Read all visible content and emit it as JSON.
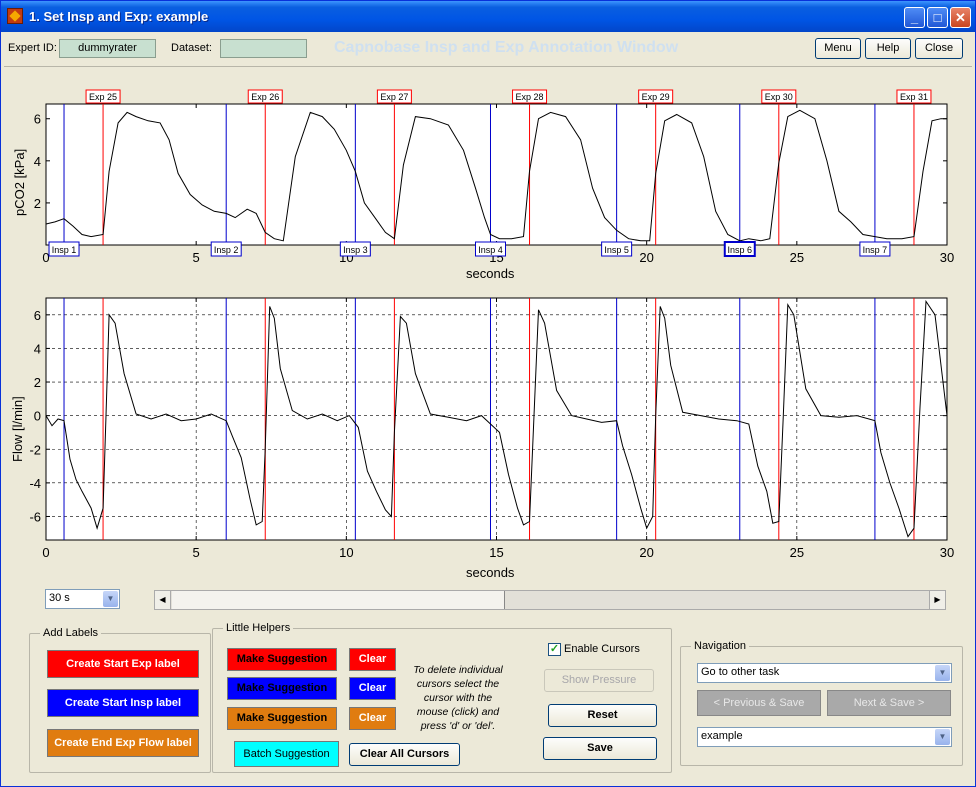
{
  "window": {
    "title": "1. Set Insp and Exp: example"
  },
  "header": {
    "expert_label": "Expert ID:",
    "expert_value": "dummyrater",
    "dataset_label": "Dataset:",
    "dataset_value": "",
    "big_title": "Capnobase Insp and Exp Annotation Window",
    "menu_label": "Menu",
    "help_label": "Help",
    "close_label": "Close"
  },
  "chart_data": [
    {
      "type": "line",
      "ylabel": "pCO2 [kPa]",
      "xlabel": "seconds",
      "xlim": [
        0,
        30
      ],
      "ylim": [
        0,
        6.7
      ],
      "xticks": [
        0,
        5,
        10,
        15,
        20,
        25,
        30
      ],
      "yticks": [
        2,
        4,
        6
      ],
      "grid": false,
      "exp_labels": [
        {
          "label": "Exp 25",
          "x": 1.9
        },
        {
          "label": "Exp 26",
          "x": 7.3
        },
        {
          "label": "Exp 27",
          "x": 11.6
        },
        {
          "label": "Exp 28",
          "x": 16.1
        },
        {
          "label": "Exp 29",
          "x": 20.3
        },
        {
          "label": "Exp 30",
          "x": 24.4
        },
        {
          "label": "Exp 31",
          "x": 28.9
        }
      ],
      "insp_labels": [
        {
          "label": "Insp 1",
          "x": 0.6
        },
        {
          "label": "Insp 2",
          "x": 6.0
        },
        {
          "label": "Insp 3",
          "x": 10.3
        },
        {
          "label": "Insp 4",
          "x": 14.8
        },
        {
          "label": "Insp 5",
          "x": 19.0
        },
        {
          "label": "Insp 6",
          "x": 23.1
        },
        {
          "label": "Insp 7",
          "x": 27.6
        }
      ],
      "series": [
        {
          "x": [
            0,
            0.3,
            0.6,
            0.9,
            1.2,
            1.5,
            1.9,
            2.1,
            2.4,
            2.7,
            3.0,
            3.4,
            3.8,
            4.1,
            4.4,
            4.8,
            5.2,
            5.6,
            6.0,
            6.3,
            6.7,
            7.0,
            7.3,
            7.6,
            7.9,
            8.3,
            8.8,
            9.2,
            9.6,
            10.0,
            10.3,
            10.6,
            11.0,
            11.3,
            11.6,
            11.9,
            12.3,
            12.8,
            13.4,
            13.9,
            14.3,
            14.6,
            14.8,
            15.1,
            15.5,
            15.9,
            16.1,
            16.4,
            16.8,
            17.3,
            17.8,
            18.2,
            18.6,
            19.0,
            19.4,
            19.8,
            20.1,
            20.3,
            20.6,
            21.0,
            21.5,
            21.9,
            22.3,
            22.7,
            23.1,
            23.4,
            23.8,
            24.1,
            24.4,
            24.7,
            25.1,
            25.6,
            26.0,
            26.4,
            26.8,
            27.2,
            27.6,
            28.0,
            28.5,
            28.9,
            29.2,
            29.5,
            29.8,
            30.0
          ],
          "y": [
            1.0,
            1.1,
            1.25,
            0.9,
            0.5,
            0.4,
            0.5,
            3.5,
            5.8,
            6.3,
            6.1,
            5.9,
            5.8,
            5.0,
            3.4,
            2.4,
            1.9,
            1.6,
            1.5,
            1.3,
            1.7,
            1.5,
            0.6,
            0.3,
            0.2,
            4.2,
            6.3,
            6.1,
            5.5,
            4.5,
            3.5,
            2.0,
            1.2,
            0.6,
            0.3,
            3.8,
            6.1,
            6.0,
            5.7,
            4.5,
            2.7,
            1.3,
            0.5,
            0.3,
            0.3,
            0.4,
            3.5,
            6.0,
            6.3,
            6.1,
            5.0,
            2.7,
            1.3,
            0.7,
            0.3,
            0.2,
            0.2,
            3.4,
            5.9,
            6.2,
            5.8,
            4.2,
            1.6,
            0.5,
            0.2,
            0.3,
            0.2,
            0.3,
            3.9,
            6.1,
            6.4,
            6.0,
            4.0,
            1.6,
            1.1,
            0.5,
            0.4,
            0.3,
            0.3,
            0.4,
            3.5,
            5.9,
            6.0,
            6.0
          ]
        }
      ]
    },
    {
      "type": "line",
      "ylabel": "Flow  [l/min]",
      "xlabel": "seconds",
      "xlim": [
        0,
        30
      ],
      "ylim": [
        -7.4,
        7.0
      ],
      "xticks": [
        0,
        5,
        10,
        15,
        20,
        25,
        30
      ],
      "yticks": [
        -6,
        -4,
        -2,
        0,
        2,
        4,
        6
      ],
      "grid": true,
      "series": [
        {
          "x": [
            0,
            0.2,
            0.4,
            0.6,
            0.8,
            1.0,
            1.2,
            1.5,
            1.7,
            1.9,
            2.0,
            2.1,
            2.3,
            2.6,
            3.0,
            3.5,
            4.0,
            4.5,
            5.0,
            5.5,
            6.0,
            6.2,
            6.5,
            6.8,
            7.0,
            7.2,
            7.3,
            7.45,
            7.6,
            7.8,
            8.2,
            8.7,
            9.2,
            9.7,
            10.1,
            10.4,
            10.7,
            11.0,
            11.3,
            11.5,
            11.6,
            11.8,
            12.0,
            12.3,
            12.8,
            13.4,
            14.0,
            14.5,
            14.8,
            15.1,
            15.4,
            15.7,
            15.9,
            16.1,
            16.25,
            16.4,
            16.6,
            17.0,
            17.5,
            18.0,
            18.5,
            19.0,
            19.2,
            19.5,
            19.8,
            20.0,
            20.2,
            20.3,
            20.45,
            20.6,
            20.8,
            21.2,
            21.8,
            22.4,
            23.0,
            23.4,
            23.7,
            24.0,
            24.2,
            24.4,
            24.55,
            24.7,
            24.9,
            25.3,
            25.8,
            26.4,
            27.0,
            27.6,
            27.8,
            28.1,
            28.4,
            28.7,
            28.9,
            29.1,
            29.3,
            29.6,
            30.0
          ],
          "y": [
            0,
            -0.6,
            -0.2,
            -0.3,
            -2.6,
            -3.8,
            -4.5,
            -5.5,
            -6.7,
            -5.5,
            0.2,
            6.0,
            5.5,
            2.5,
            0.1,
            -0.2,
            0.1,
            -0.3,
            -0.2,
            0.1,
            -0.3,
            -1.2,
            -2.5,
            -5.0,
            -6.5,
            -6.3,
            -2.0,
            6.5,
            5.8,
            2.8,
            0.3,
            -0.2,
            0.1,
            -0.3,
            0.0,
            -0.7,
            -3.3,
            -4.5,
            -5.6,
            -6.0,
            -1.0,
            5.9,
            5.5,
            2.5,
            0.1,
            -0.1,
            -0.3,
            0.0,
            -0.5,
            -1.0,
            -3.5,
            -5.5,
            -6.5,
            -6.3,
            0.0,
            6.3,
            5.5,
            1.5,
            0.0,
            -0.2,
            -0.4,
            -0.3,
            -1.8,
            -3.5,
            -5.5,
            -6.7,
            -6.0,
            0.0,
            6.5,
            5.8,
            3.0,
            0.2,
            0.0,
            -0.2,
            -0.3,
            -0.5,
            -3.0,
            -4.5,
            -6.4,
            -6.3,
            0.0,
            6.6,
            6.0,
            1.6,
            0.0,
            -0.1,
            0.0,
            -0.3,
            -2.2,
            -4.0,
            -5.5,
            -7.2,
            -6.7,
            0.5,
            6.8,
            6.0,
            0.0
          ]
        }
      ]
    }
  ],
  "zoom": {
    "value": "30 s"
  },
  "scroll": {
    "position": 0.44
  },
  "add_labels": {
    "title": "Add Labels",
    "exp_label": "Create Start Exp label",
    "insp_label": "Create Start Insp label",
    "end_label": "Create End Exp Flow label"
  },
  "helpers": {
    "title": "Little Helpers",
    "suggest": "Make Suggestion",
    "clear": "Clear",
    "batch": "Batch Suggestion",
    "clear_all": "Clear All Cursors",
    "note": "To delete individual cursors select the cursor with the mouse (click) and press 'd' or 'del'.",
    "enable_cursors": "Enable Cursors",
    "show_pressure": "Show Pressure",
    "reset": "Reset",
    "save": "Save"
  },
  "navigation": {
    "title": "Navigation",
    "task_select": "Go to other task",
    "prev": "< Previous & Save",
    "next": "Next & Save >",
    "dataset_select": "example"
  }
}
